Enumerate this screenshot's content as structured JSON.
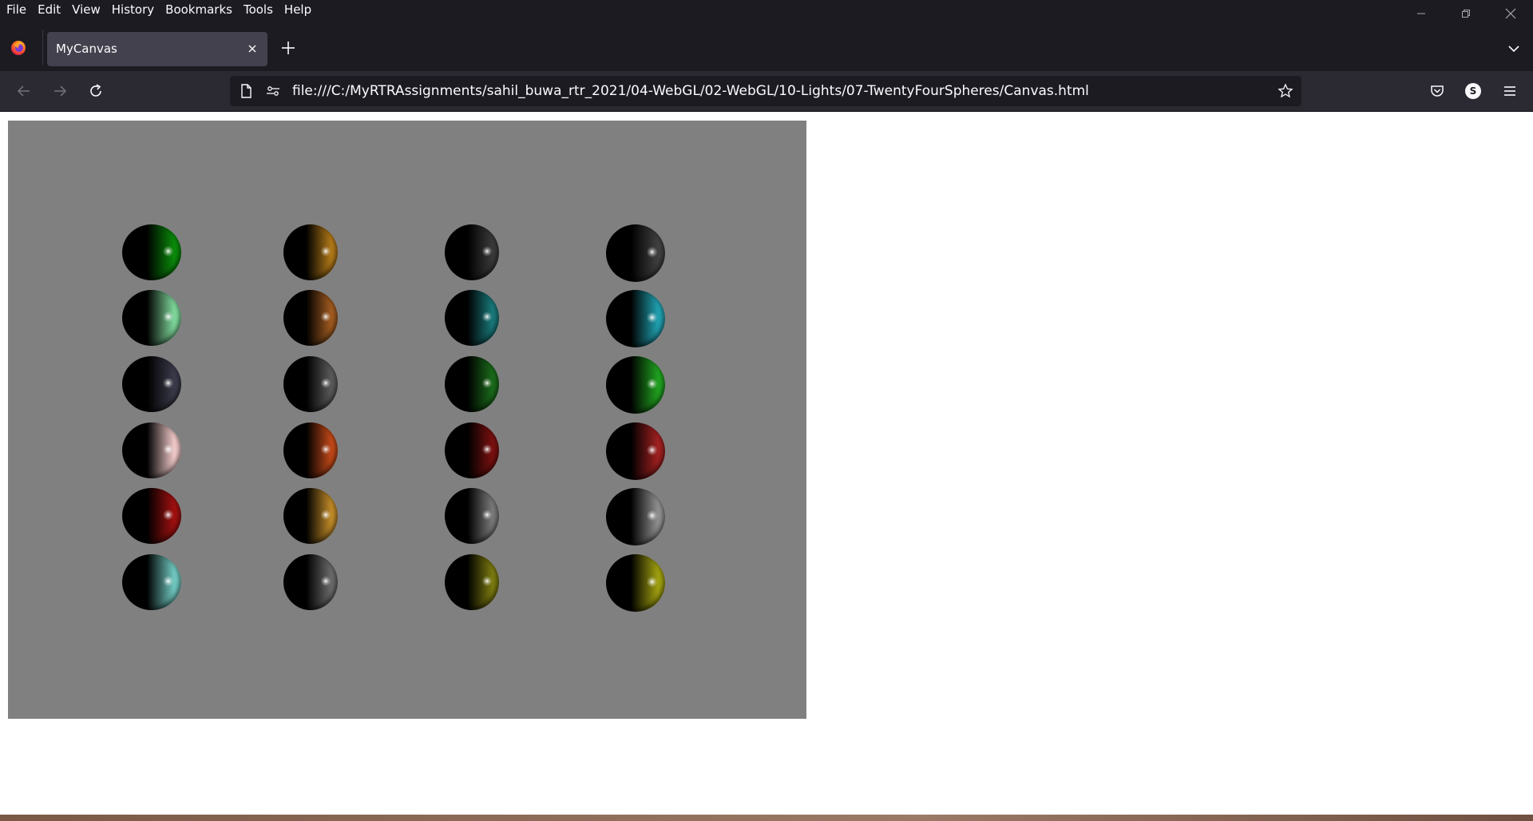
{
  "menubar": {
    "items": [
      "File",
      "Edit",
      "View",
      "History",
      "Bookmarks",
      "Tools",
      "Help"
    ]
  },
  "window_controls": {
    "minimize_icon": "minimize-icon",
    "restore_icon": "restore-icon",
    "close_icon": "close-icon"
  },
  "tabs": [
    {
      "title": "MyCanvas",
      "active": true
    }
  ],
  "navbar": {
    "url": "file:///C:/MyRTRAssignments/sahil_buwa_rtr_2021/04-WebGL/02-WebGL/10-Lights/07-TwentyFourSpheres/Canvas.html",
    "account_initial": "S"
  },
  "canvas": {
    "background": "#808080",
    "rows": 6,
    "columns": 4,
    "spheres": [
      [
        "#0a8a0a",
        "#b07818",
        "#3a3a3a",
        "#404040"
      ],
      [
        "#7ed69a",
        "#a05a20",
        "#18787a",
        "#20a0b0"
      ],
      [
        "#3a3a4a",
        "#5a5a5a",
        "#1a6a1a",
        "#20a020"
      ],
      [
        "#f0c8c8",
        "#c04818",
        "#7a1010",
        "#a02020"
      ],
      [
        "#a01010",
        "#c08a28",
        "#7a7a7a",
        "#909090"
      ],
      [
        "#70c8c0",
        "#6a6a6a",
        "#7a7a10",
        "#a0a010"
      ]
    ]
  }
}
